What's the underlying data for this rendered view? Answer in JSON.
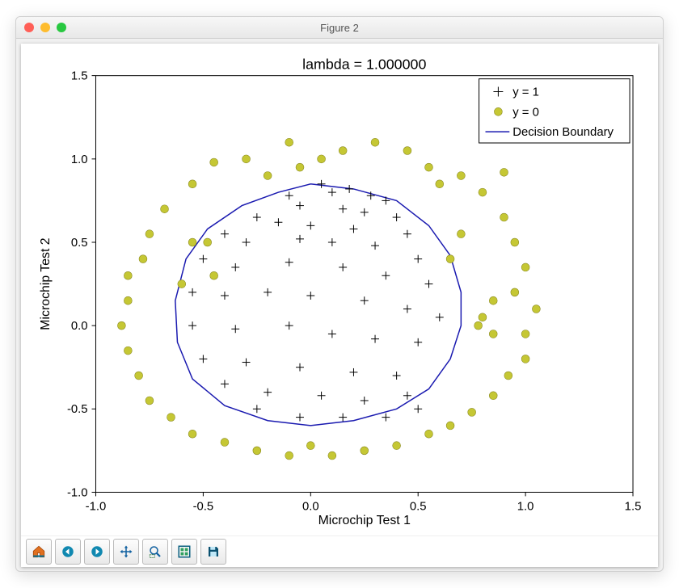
{
  "window": {
    "title": "Figure 2"
  },
  "toolbar": {
    "home": "Home",
    "back": "Back",
    "forward": "Forward",
    "pan": "Pan",
    "zoom": "Zoom",
    "subplots": "Subplots",
    "save": "Save"
  },
  "chart_data": {
    "type": "scatter",
    "title": "lambda = 1.000000",
    "xlabel": "Microchip Test 1",
    "ylabel": "Microchip Test 2",
    "xlim": [
      -1.0,
      1.5
    ],
    "ylim": [
      -1.0,
      1.5
    ],
    "xticks": [
      -1.0,
      -0.5,
      0.0,
      0.5,
      1.0,
      1.5
    ],
    "yticks": [
      -1.0,
      -0.5,
      0.0,
      0.5,
      1.0,
      1.5
    ],
    "legend": {
      "position": "upper right",
      "entries": [
        "y = 1",
        "y = 0",
        "Decision Boundary"
      ]
    },
    "series": [
      {
        "name": "y = 1",
        "marker": "plus",
        "color": "#000000",
        "points": [
          [
            0.05,
            0.85
          ],
          [
            0.1,
            0.8
          ],
          [
            0.18,
            0.82
          ],
          [
            0.28,
            0.78
          ],
          [
            0.35,
            0.75
          ],
          [
            -0.1,
            0.78
          ],
          [
            -0.05,
            0.72
          ],
          [
            0.15,
            0.7
          ],
          [
            0.25,
            0.68
          ],
          [
            0.4,
            0.65
          ],
          [
            -0.25,
            0.65
          ],
          [
            -0.15,
            0.62
          ],
          [
            0.0,
            0.6
          ],
          [
            0.2,
            0.58
          ],
          [
            0.45,
            0.55
          ],
          [
            -0.4,
            0.55
          ],
          [
            -0.3,
            0.5
          ],
          [
            -0.05,
            0.52
          ],
          [
            0.1,
            0.5
          ],
          [
            0.3,
            0.48
          ],
          [
            0.5,
            0.4
          ],
          [
            -0.5,
            0.4
          ],
          [
            -0.35,
            0.35
          ],
          [
            -0.1,
            0.38
          ],
          [
            0.15,
            0.35
          ],
          [
            0.35,
            0.3
          ],
          [
            0.55,
            0.25
          ],
          [
            -0.55,
            0.2
          ],
          [
            -0.4,
            0.18
          ],
          [
            -0.2,
            0.2
          ],
          [
            0.0,
            0.18
          ],
          [
            0.25,
            0.15
          ],
          [
            0.45,
            0.1
          ],
          [
            0.6,
            0.05
          ],
          [
            -0.55,
            0.0
          ],
          [
            -0.35,
            -0.02
          ],
          [
            -0.1,
            0.0
          ],
          [
            0.1,
            -0.05
          ],
          [
            0.3,
            -0.08
          ],
          [
            0.5,
            -0.1
          ],
          [
            -0.5,
            -0.2
          ],
          [
            -0.3,
            -0.22
          ],
          [
            -0.05,
            -0.25
          ],
          [
            0.2,
            -0.28
          ],
          [
            0.4,
            -0.3
          ],
          [
            -0.4,
            -0.35
          ],
          [
            -0.2,
            -0.4
          ],
          [
            0.05,
            -0.42
          ],
          [
            0.25,
            -0.45
          ],
          [
            0.45,
            -0.42
          ],
          [
            -0.25,
            -0.5
          ],
          [
            -0.05,
            -0.55
          ],
          [
            0.15,
            -0.55
          ],
          [
            0.35,
            -0.55
          ],
          [
            0.5,
            -0.5
          ]
        ]
      },
      {
        "name": "y = 0",
        "marker": "circle",
        "color": "#c5c734",
        "points": [
          [
            -0.1,
            1.1
          ],
          [
            0.15,
            1.05
          ],
          [
            0.3,
            1.1
          ],
          [
            0.45,
            1.05
          ],
          [
            0.55,
            0.95
          ],
          [
            -0.3,
            1.0
          ],
          [
            -0.45,
            0.98
          ],
          [
            0.7,
            0.9
          ],
          [
            0.8,
            0.8
          ],
          [
            -0.55,
            0.85
          ],
          [
            -0.68,
            0.7
          ],
          [
            0.9,
            0.65
          ],
          [
            0.95,
            0.5
          ],
          [
            -0.55,
            0.5
          ],
          [
            -0.48,
            0.5
          ],
          [
            -0.75,
            0.55
          ],
          [
            -0.78,
            0.4
          ],
          [
            1.0,
            0.35
          ],
          [
            0.95,
            0.2
          ],
          [
            -0.85,
            0.3
          ],
          [
            -0.85,
            0.15
          ],
          [
            1.05,
            0.1
          ],
          [
            1.0,
            -0.05
          ],
          [
            0.85,
            -0.05
          ],
          [
            0.8,
            0.05
          ],
          [
            0.78,
            0.0
          ],
          [
            -0.88,
            0.0
          ],
          [
            -0.85,
            -0.15
          ],
          [
            1.0,
            -0.2
          ],
          [
            0.92,
            -0.3
          ],
          [
            -0.8,
            -0.3
          ],
          [
            -0.75,
            -0.45
          ],
          [
            0.85,
            -0.42
          ],
          [
            0.75,
            -0.52
          ],
          [
            -0.65,
            -0.55
          ],
          [
            -0.55,
            -0.65
          ],
          [
            0.65,
            -0.6
          ],
          [
            0.55,
            -0.65
          ],
          [
            -0.4,
            -0.7
          ],
          [
            -0.25,
            -0.75
          ],
          [
            0.4,
            -0.72
          ],
          [
            0.25,
            -0.75
          ],
          [
            -0.1,
            -0.78
          ],
          [
            0.1,
            -0.78
          ],
          [
            0.0,
            -0.72
          ],
          [
            -0.45,
            0.3
          ],
          [
            0.65,
            0.4
          ],
          [
            0.7,
            0.55
          ],
          [
            -0.6,
            0.25
          ],
          [
            0.85,
            0.15
          ],
          [
            0.9,
            0.92
          ],
          [
            0.6,
            0.85
          ],
          [
            -0.2,
            0.9
          ],
          [
            -0.05,
            0.95
          ],
          [
            0.05,
            1.0
          ]
        ]
      },
      {
        "name": "Decision Boundary",
        "type": "line",
        "color": "#1a1ab0",
        "path": [
          [
            0.0,
            0.85
          ],
          [
            0.2,
            0.82
          ],
          [
            0.4,
            0.75
          ],
          [
            0.55,
            0.6
          ],
          [
            0.65,
            0.42
          ],
          [
            0.7,
            0.2
          ],
          [
            0.7,
            0.0
          ],
          [
            0.65,
            -0.2
          ],
          [
            0.55,
            -0.38
          ],
          [
            0.4,
            -0.5
          ],
          [
            0.2,
            -0.57
          ],
          [
            0.0,
            -0.6
          ],
          [
            -0.2,
            -0.57
          ],
          [
            -0.4,
            -0.48
          ],
          [
            -0.55,
            -0.32
          ],
          [
            -0.62,
            -0.1
          ],
          [
            -0.63,
            0.15
          ],
          [
            -0.58,
            0.4
          ],
          [
            -0.48,
            0.58
          ],
          [
            -0.32,
            0.72
          ],
          [
            -0.15,
            0.8
          ],
          [
            0.0,
            0.85
          ]
        ]
      }
    ]
  }
}
